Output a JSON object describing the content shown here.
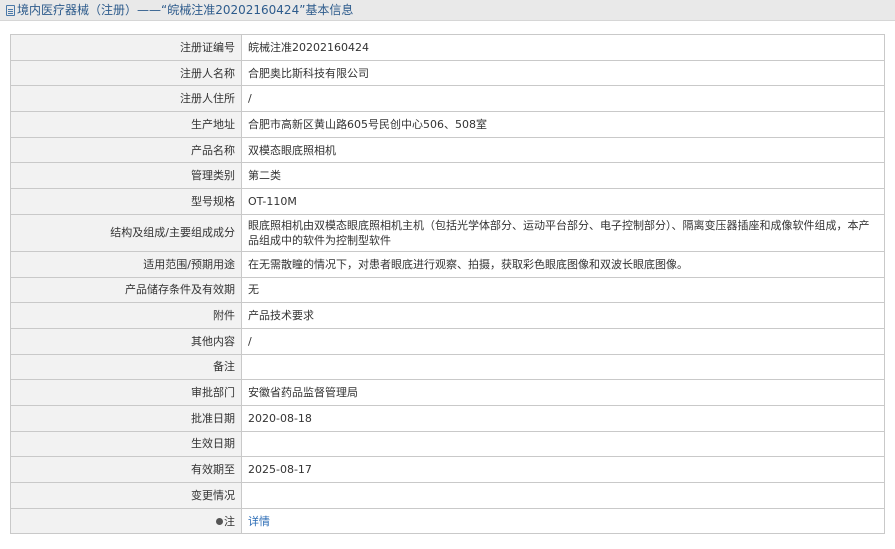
{
  "header": {
    "title": "境内医疗器械（注册）——“皖械注准20202160424”基本信息"
  },
  "rows": [
    {
      "label": "注册证编号",
      "value": "皖械注准20202160424"
    },
    {
      "label": "注册人名称",
      "value": "合肥奥比斯科技有限公司"
    },
    {
      "label": "注册人住所",
      "value": "/"
    },
    {
      "label": "生产地址",
      "value": "合肥市高新区黄山路605号民创中心506、508室"
    },
    {
      "label": "产品名称",
      "value": "双模态眼底照相机"
    },
    {
      "label": "管理类别",
      "value": "第二类"
    },
    {
      "label": "型号规格",
      "value": "OT-110M"
    },
    {
      "label": "结构及组成/主要组成成分",
      "value": "眼底照相机由双模态眼底照相机主机（包括光学体部分、运动平台部分、电子控制部分）、隔离变压器插座和成像软件组成，本产品组成中的软件为控制型软件"
    },
    {
      "label": "适用范围/预期用途",
      "value": "在无需散瞳的情况下，对患者眼底进行观察、拍摄，获取彩色眼底图像和双波长眼底图像。"
    },
    {
      "label": "产品储存条件及有效期",
      "value": "无"
    },
    {
      "label": "附件",
      "value": "产品技术要求"
    },
    {
      "label": "其他内容",
      "value": "/"
    },
    {
      "label": "备注",
      "value": ""
    },
    {
      "label": "审批部门",
      "value": "安徽省药品监督管理局"
    },
    {
      "label": "批准日期",
      "value": "2020-08-18"
    },
    {
      "label": "生效日期",
      "value": ""
    },
    {
      "label": "有效期至",
      "value": "2025-08-17"
    },
    {
      "label": "变更情况",
      "value": ""
    }
  ],
  "note": {
    "label": "注",
    "link_text": "详情",
    "icon": "pin-icon"
  }
}
